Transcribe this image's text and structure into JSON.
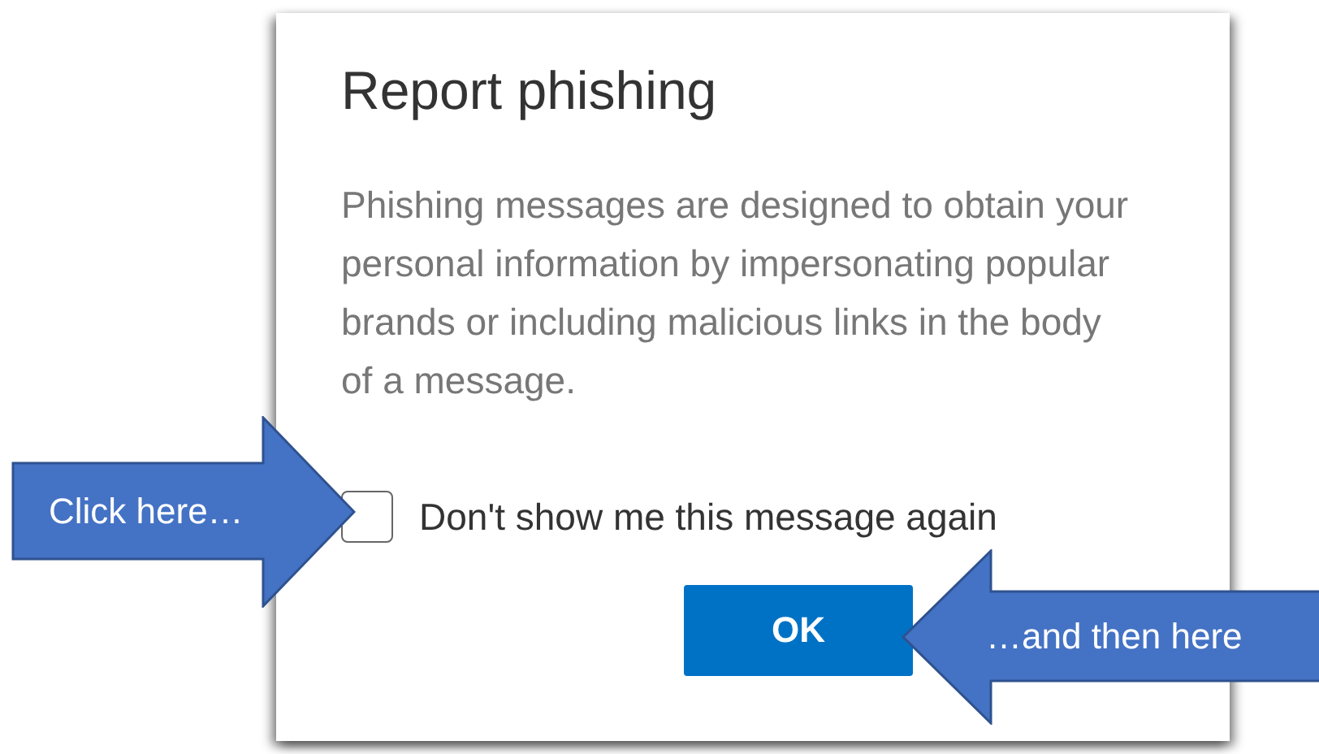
{
  "dialog": {
    "title": "Report phishing",
    "message": "Phishing messages are designed to obtain your personal information by impersonating popular brands or including malicious links in the body of a message.",
    "checkbox": {
      "label": "Don't show me this message again",
      "checked": false
    },
    "buttons": [
      {
        "label": "OK",
        "kind": "primary"
      }
    ]
  },
  "callouts": [
    {
      "text": "Click here…",
      "kind": "right"
    },
    {
      "text": "…and then here",
      "kind": "left"
    }
  ]
}
